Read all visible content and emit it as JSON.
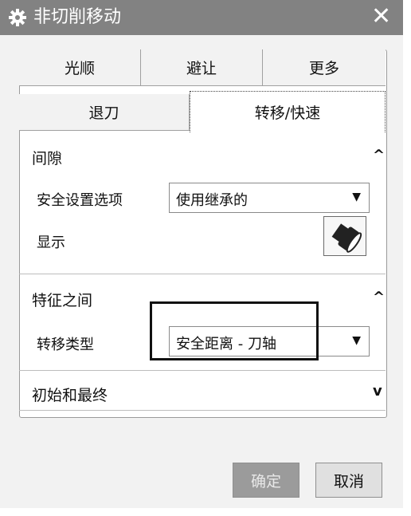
{
  "window": {
    "title": "非切削移动",
    "close_label": "✕",
    "icon": "gear-icon"
  },
  "tabs": {
    "row1": [
      "光顺",
      "避让",
      "更多"
    ],
    "row2": [
      "退刀",
      "转移/快速"
    ],
    "active": "转移/快速"
  },
  "sections": {
    "clearance": {
      "title": "间隙",
      "expanded": true,
      "safety_label": "安全设置选项",
      "safety_value": "使用继承的",
      "display_label": "显示",
      "display_icon": "flashlight-icon"
    },
    "between_features": {
      "title": "特征之间",
      "expanded": true,
      "transfer_label": "转移类型",
      "transfer_value": "安全距离 - 刀轴"
    },
    "initial_final": {
      "title": "初始和最终",
      "expanded": false
    }
  },
  "buttons": {
    "ok": "确定",
    "cancel": "取消"
  }
}
